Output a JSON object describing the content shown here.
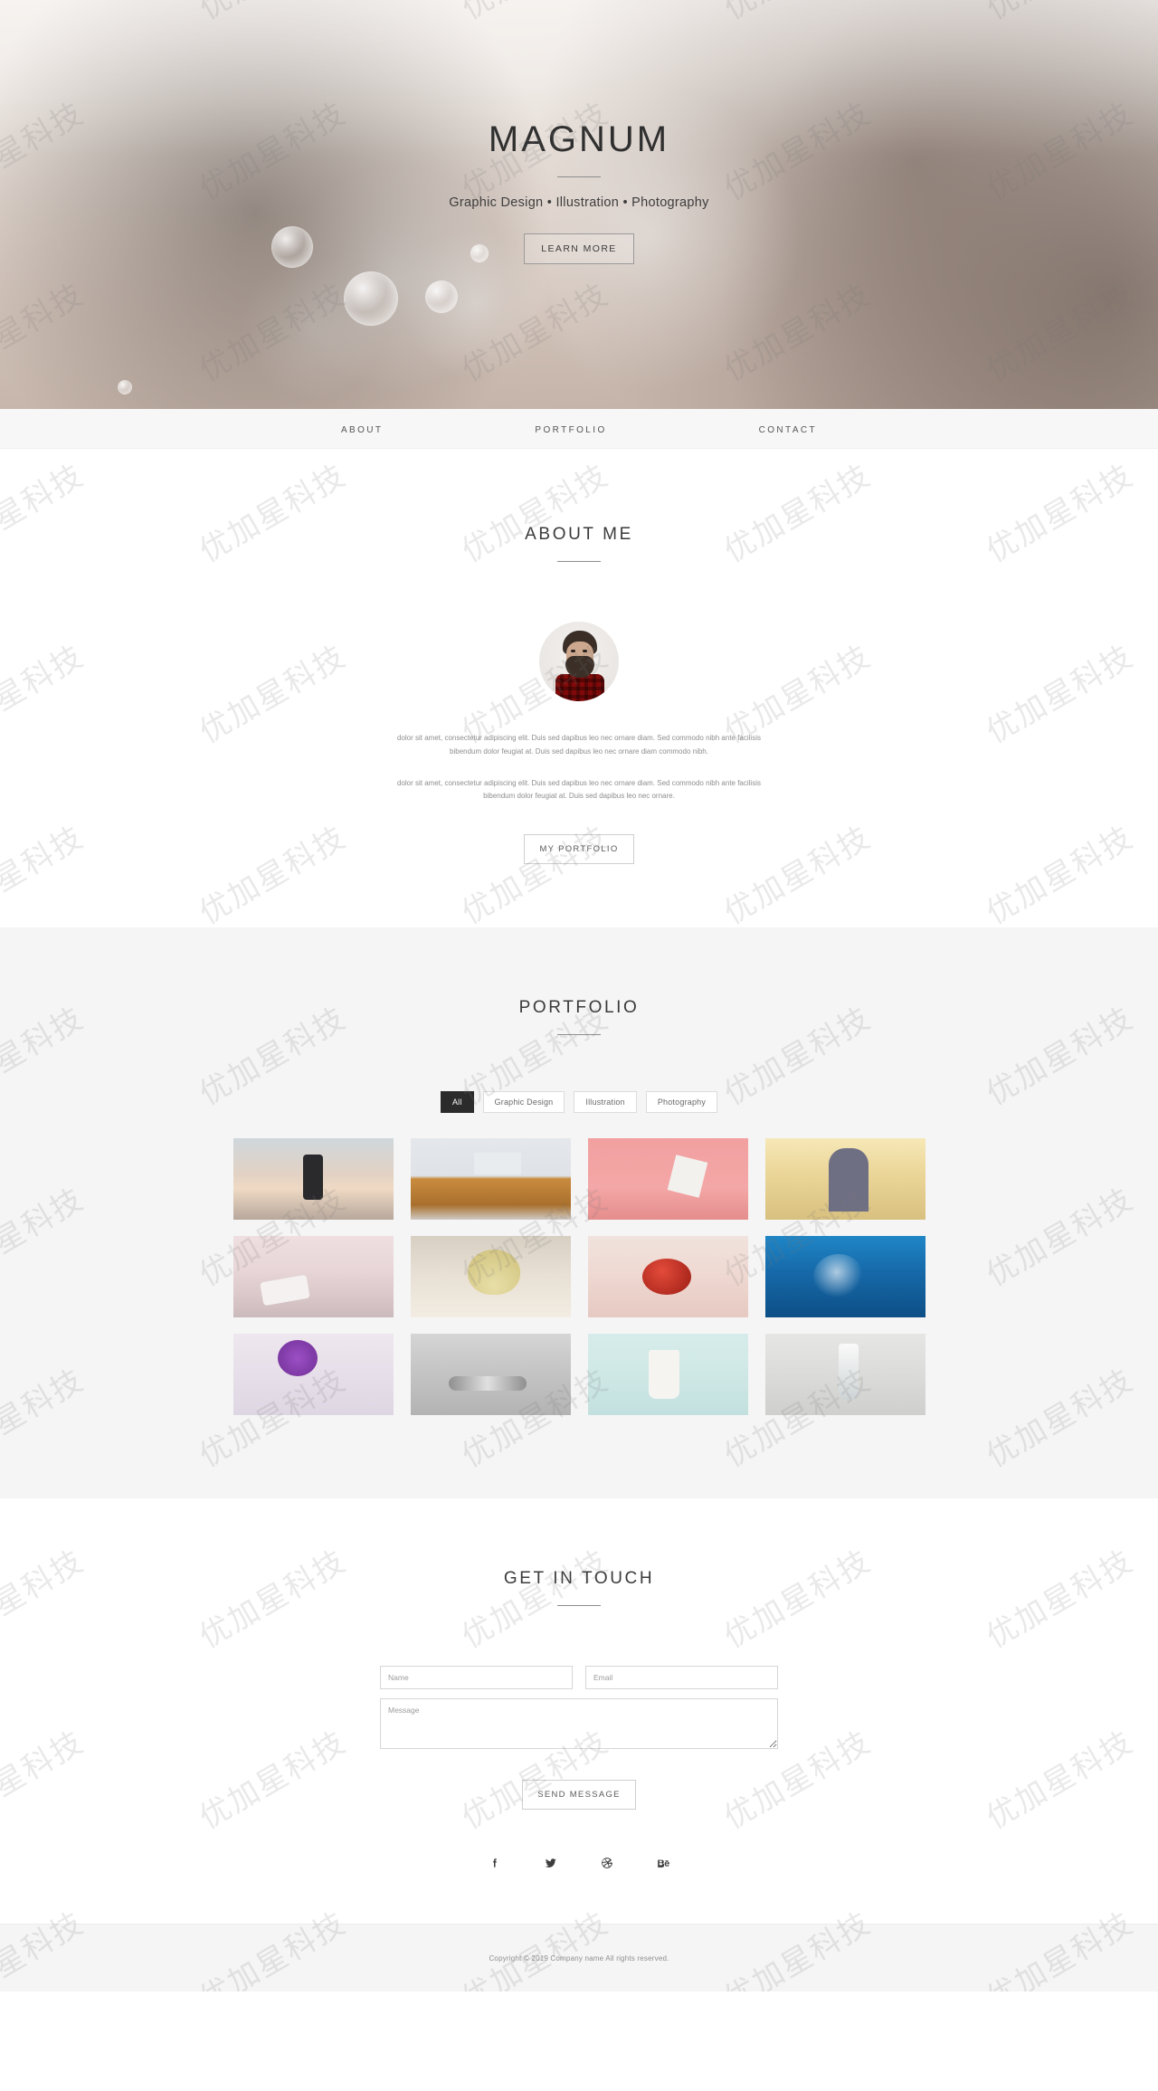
{
  "hero": {
    "title": "MAGNUM",
    "subtitle": "Graphic Design • Illustration • Photography",
    "cta_label": "LEARN MORE"
  },
  "nav": {
    "items": [
      {
        "label": "ABOUT"
      },
      {
        "label": "PORTFOLIO"
      },
      {
        "label": "CONTACT"
      }
    ]
  },
  "about": {
    "title": "ABOUT ME",
    "paragraph_1": "dolor sit amet, consectetur adipiscing elit. Duis sed dapibus leo nec ornare diam. Sed commodo nibh ante facilisis bibendum dolor feugiat at. Duis sed dapibus leo nec ornare diam commodo nibh.",
    "paragraph_2": "dolor sit amet, consectetur adipiscing elit. Duis sed dapibus leo nec ornare diam. Sed commodo nibh ante facilisis bibendum dolor feugiat at. Duis sed dapibus leo nec ornare.",
    "cta_label": "MY PORTFOLIO"
  },
  "portfolio": {
    "title": "PORTFOLIO",
    "filters": [
      {
        "label": "All",
        "active": true
      },
      {
        "label": "Graphic Design",
        "active": false
      },
      {
        "label": "Illustration",
        "active": false
      },
      {
        "label": "Photography",
        "active": false
      }
    ],
    "items": [
      {
        "alt": "hand holding phone at sunset beach"
      },
      {
        "alt": "laptop glasses and mouse on wooden desk"
      },
      {
        "alt": "business card on pink background"
      },
      {
        "alt": "woman with sunglasses in field"
      },
      {
        "alt": "smartphone and sunglasses on pink table"
      },
      {
        "alt": "seashell on white sand"
      },
      {
        "alt": "ladybug on pink surface"
      },
      {
        "alt": "water splash on blue background"
      },
      {
        "alt": "purple flowers in glass vase"
      },
      {
        "alt": "newton's cradle metal balls"
      },
      {
        "alt": "paper coffee cup on mint background"
      },
      {
        "alt": "glass bottles and goblets still life"
      }
    ]
  },
  "contact": {
    "title": "GET IN TOUCH",
    "name_placeholder": "Name",
    "email_placeholder": "Email",
    "message_placeholder": "Message",
    "name_value": "",
    "email_value": "",
    "message_value": "",
    "submit_label": "SEND MESSAGE",
    "socials": [
      {
        "name": "facebook"
      },
      {
        "name": "twitter"
      },
      {
        "name": "dribbble"
      },
      {
        "name": "behance"
      }
    ]
  },
  "footer": {
    "copyright": "Copyright © 2019 Company name All rights reserved."
  },
  "watermark": {
    "text": "优加星科技"
  },
  "colors": {
    "accent_dark": "#2b2b2b",
    "text_muted": "#8e8e8e",
    "section_alt_bg": "#f5f5f5"
  }
}
